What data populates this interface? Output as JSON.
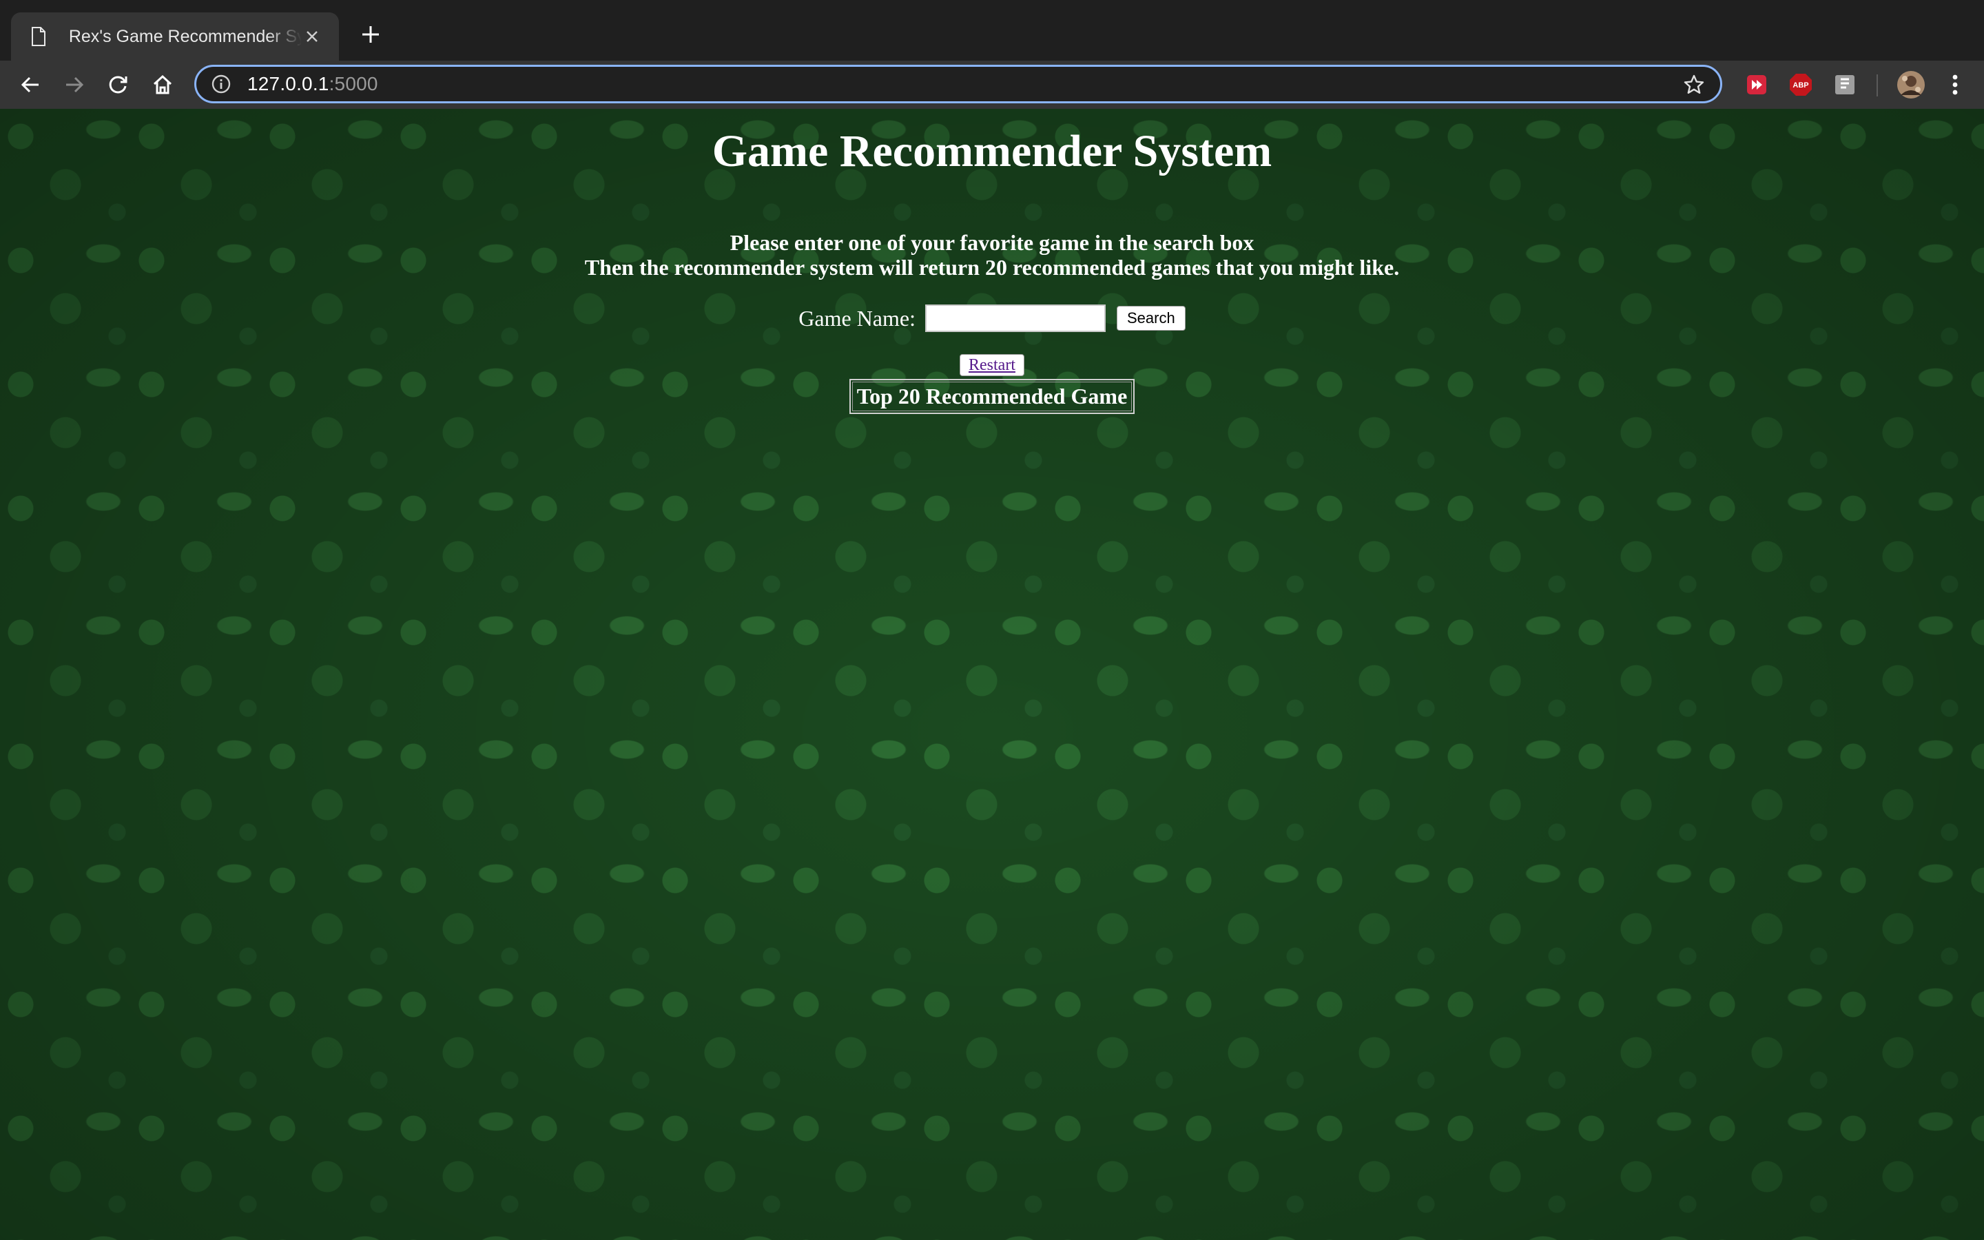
{
  "browser": {
    "tab_title": "Rex's Game Recommender System",
    "url_host": "127.0.0.1",
    "url_port": ":5000",
    "icons": {
      "tab": "page-icon",
      "close": "close-icon",
      "new_tab": "plus-icon",
      "back": "back-arrow-icon",
      "forward": "forward-arrow-icon",
      "reload": "reload-icon",
      "home": "home-icon",
      "site_info": "info-icon",
      "bookmark": "star-icon",
      "extensions": [
        "video-extension-icon",
        "adblock-plus-icon",
        "reader-extension-icon"
      ],
      "profile": "profile-avatar-icon",
      "menu": "kebab-menu-icon"
    },
    "abp_label": "ABP"
  },
  "page": {
    "title": "Game Recommender System",
    "intro_line1": "Please enter one of your favorite game in the search box",
    "intro_line2": "Then the recommender system will return 20 recommended games that you might like.",
    "form": {
      "label": "Game Name:",
      "input_value": "",
      "search_label": "Search"
    },
    "restart_label": "Restart",
    "table_header": "Top 20 Recommended Game"
  },
  "colors": {
    "background": "#1b4a20",
    "text": "#ffffff",
    "link": "#551a8b",
    "focus_ring": "#8ab4f8"
  }
}
